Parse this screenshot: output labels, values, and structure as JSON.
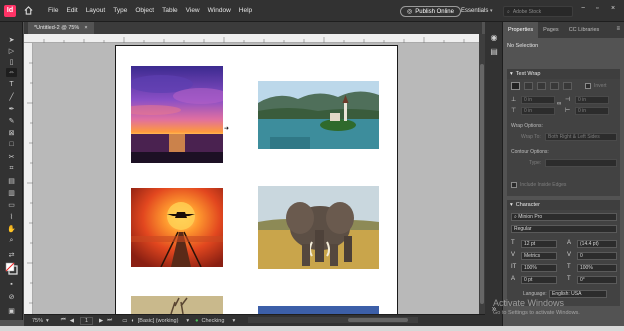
{
  "app": {
    "logo_text": "Id"
  },
  "menu": [
    "File",
    "Edit",
    "Layout",
    "Type",
    "Object",
    "Table",
    "View",
    "Window",
    "Help"
  ],
  "header": {
    "publish_label": "Publish Online",
    "workspace": "Essentials",
    "search_placeholder": "Adobe Stock"
  },
  "document": {
    "tab_title": "*Untitled-2 @ 75%",
    "tab_close": "×"
  },
  "status": {
    "zoom": "75%",
    "page": "1",
    "style": "[Basic] (working)",
    "preflight": "Checking"
  },
  "panel": {
    "tabs": [
      "Properties",
      "Pages",
      "CC Libraries"
    ],
    "selection": "No Selection",
    "text_wrap": {
      "title": "Text Wrap",
      "invert_label": "Invert",
      "top_offset": "0 in",
      "bottom_offset": "0 in",
      "left_offset": "0 in",
      "right_offset": "0 in",
      "wrap_options_label": "Wrap Options:",
      "wrap_to_label": "Wrap To:",
      "wrap_to_value": "Both Right & Left Sides",
      "contour_options_label": "Contour Options:",
      "type_label": "Type:",
      "include_inside_edges": "Include Inside Edges"
    },
    "character": {
      "title": "Character",
      "font_family": "Minion Pro",
      "font_style": "Regular",
      "font_size": "12 pt",
      "leading": "(14.4 pt)",
      "kerning": "Metrics",
      "tracking": "0",
      "vertical_scale": "100%",
      "horizontal_scale": "100%",
      "baseline_shift": "0 pt",
      "skew": "0°",
      "language_label": "Language:",
      "language_value": "English: USA"
    }
  },
  "watermark": {
    "title": "Activate Windows",
    "subtitle": "Go to Settings to activate Windows."
  },
  "colors": {
    "chrome_dark": "#323232",
    "panel_bg": "#535353",
    "pasteboard": "#b9b9b9",
    "page": "#ffffff",
    "brand": "#ff3366"
  },
  "icons": {
    "tools": [
      "selection-icon",
      "direct-selection-icon",
      "page-tool-icon",
      "gap-tool-icon",
      "type-icon",
      "line-icon",
      "pen-icon",
      "pencil-icon",
      "rectangle-frame-icon",
      "rectangle-icon",
      "scissors-icon",
      "free-transform-icon",
      "gradient-icon",
      "note-icon",
      "eyedropper-icon",
      "hand-icon",
      "zoom-icon",
      "fill-stroke-icon",
      "apply-color-icon",
      "normal-view-icon"
    ]
  }
}
